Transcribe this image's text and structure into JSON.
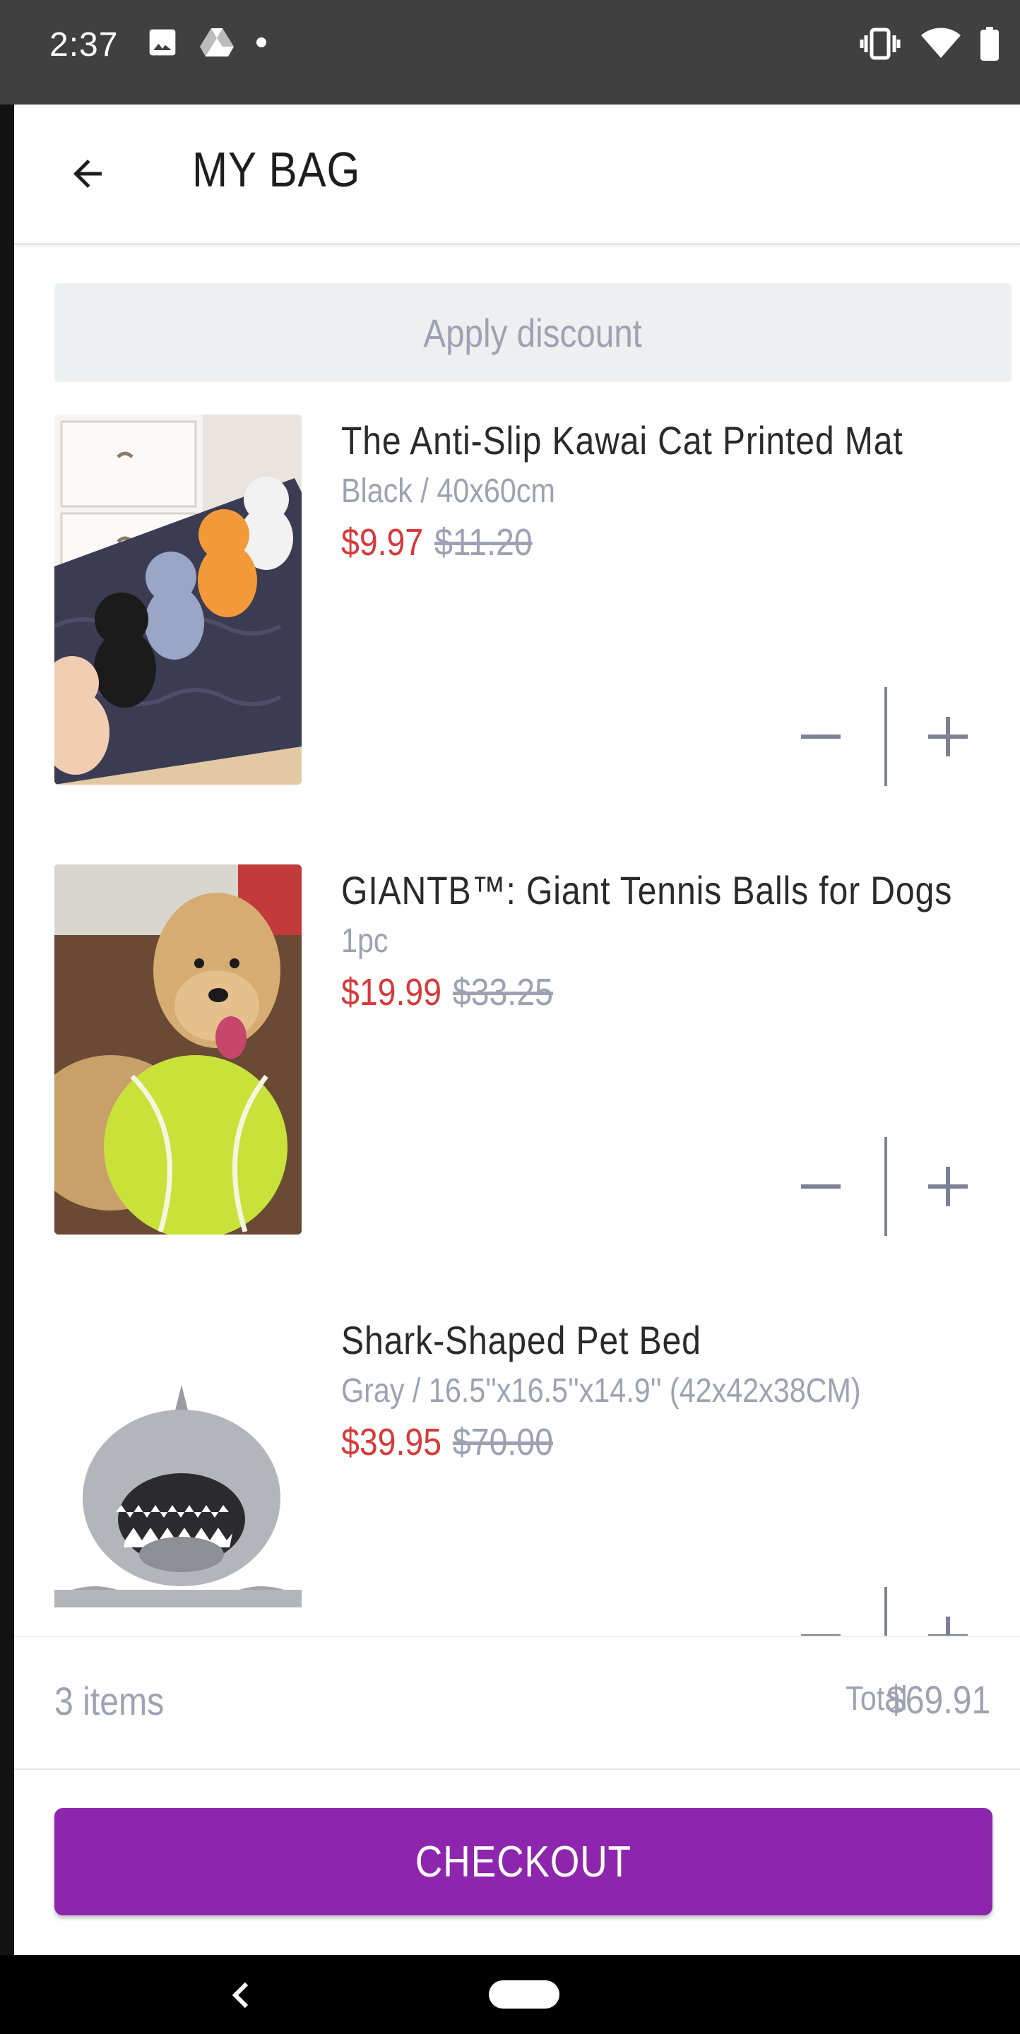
{
  "status_bar": {
    "time": "2:37",
    "left_icons": [
      "image-icon",
      "drive-icon",
      "dot-icon"
    ],
    "right_icons": [
      "vibrate-icon",
      "wifi-icon",
      "battery-icon"
    ]
  },
  "header": {
    "title": "MY BAG",
    "back_icon": "arrow-left-icon"
  },
  "discount": {
    "label": "Apply discount"
  },
  "items": [
    {
      "name": "The Anti-Slip Kawai Cat Printed Mat",
      "variant": "Black / 40x60cm",
      "price": "$9.97",
      "old_price": "$11.20"
    },
    {
      "name": "GIANTB™: Giant Tennis Balls for Dogs",
      "variant": "1pc",
      "price": "$19.99",
      "old_price": "$33.25"
    },
    {
      "name": "Shark-Shaped Pet Bed",
      "variant": "Gray / 16.5''x16.5''x14.9'' (42x42x38CM)",
      "price": "$39.95",
      "old_price": "$70.00"
    }
  ],
  "summary": {
    "count": "3 items",
    "total_label": "Total",
    "total_value": "$69.91"
  },
  "checkout": {
    "label": "CHECKOUT"
  },
  "colors": {
    "accent": "#8e26ad",
    "sale_price": "#d63a3a",
    "muted": "#9da2b3"
  }
}
